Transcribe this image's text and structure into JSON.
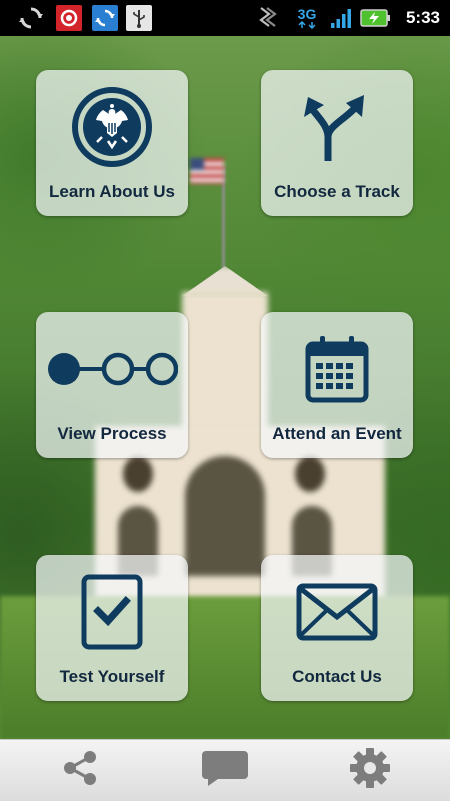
{
  "status_bar": {
    "time": "5:33",
    "network": "3G",
    "icons": [
      "sync-icon",
      "email-icon",
      "update-icon",
      "usb-icon",
      "wifi-signal-icon",
      "3g-icon",
      "signal-bars-icon",
      "battery-charging-icon"
    ]
  },
  "tiles": [
    {
      "id": "learn",
      "label": "Learn About Us",
      "icon": "seal-icon"
    },
    {
      "id": "track",
      "label": "Choose a Track",
      "icon": "split-arrow-icon"
    },
    {
      "id": "process",
      "label": "View Process",
      "icon": "process-steps-icon"
    },
    {
      "id": "event",
      "label": "Attend an Event",
      "icon": "calendar-icon"
    },
    {
      "id": "test",
      "label": "Test Yourself",
      "icon": "checklist-icon"
    },
    {
      "id": "contact",
      "label": "Contact Us",
      "icon": "envelope-icon"
    }
  ],
  "bottom_bar": {
    "icons": [
      "share-icon",
      "chat-icon",
      "settings-gear-icon"
    ]
  },
  "colors": {
    "icon_navy": "#0f3b5f",
    "label": "#12283f",
    "tile_bg": "rgba(244,247,249,0.72)",
    "status_bar": "#000000",
    "accent_blue": "#35a7e6"
  }
}
